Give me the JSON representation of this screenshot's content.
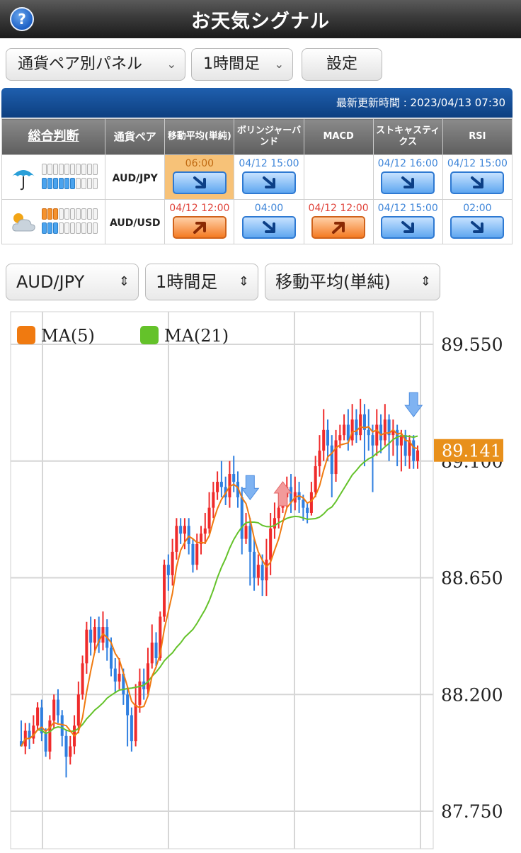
{
  "header": {
    "help_icon": "?",
    "title": "お天気シグナル"
  },
  "toolbar": {
    "panel_select": "通貨ペア別パネル",
    "timeframe_select": "1時間足",
    "settings_button": "設定"
  },
  "update": {
    "text": "最新更新時間 : 2023/04/13 07:30"
  },
  "table": {
    "headers": [
      "総合判断",
      "通貨ペア",
      "移動平均(単純)",
      "ボリンジャーバンド",
      "MACD",
      "ストキャスティクス",
      "RSI"
    ],
    "rows": [
      {
        "weather": "umbrella-rain-icon",
        "meter_top_lit": 0,
        "meter_bottom_lit": 6,
        "pair": "AUD/JPY",
        "signals": [
          {
            "time": "06:00",
            "dir": "down",
            "highlight": true
          },
          {
            "time": "04/12 15:00",
            "dir": "down"
          },
          {
            "time": "",
            "dir": ""
          },
          {
            "time": "04/12 16:00",
            "dir": "down"
          },
          {
            "time": "04/12 15:00",
            "dir": "down"
          }
        ]
      },
      {
        "weather": "cloudy-icon",
        "meter_top_lit": 3,
        "meter_bottom_lit": 3,
        "pair": "AUD/USD",
        "signals": [
          {
            "time": "04/12 12:00",
            "dir": "up"
          },
          {
            "time": "04:00",
            "dir": "down"
          },
          {
            "time": "04/12 12:00",
            "dir": "up"
          },
          {
            "time": "04/12 15:00",
            "dir": "down"
          },
          {
            "time": "02:00",
            "dir": "down"
          }
        ]
      }
    ]
  },
  "chart_controls": {
    "pair": "AUD/JPY",
    "timeframe": "1時間足",
    "indicator": "移動平均(単純)"
  },
  "chart_data": {
    "type": "candlestick",
    "legend": [
      {
        "name": "MA(5)",
        "color": "#f07a10"
      },
      {
        "name": "MA(21)",
        "color": "#64c22a"
      }
    ],
    "y_ticks": [
      "89.550",
      "89.100",
      "88.650",
      "88.200",
      "87.750"
    ],
    "ylim": [
      87.75,
      89.55
    ],
    "current_price": "89.141",
    "up_color": "#ef2b2b",
    "down_color": "#2f7fe0",
    "candles": [
      [
        88.02,
        88.0,
        88.1,
        88.0
      ],
      [
        88.0,
        88.06,
        88.09,
        87.97
      ],
      [
        88.06,
        88.03,
        88.09,
        87.99
      ],
      [
        88.03,
        88.08,
        88.12,
        88.01
      ],
      [
        88.08,
        88.15,
        88.17,
        88.06
      ],
      [
        88.15,
        88.05,
        88.18,
        88.02
      ],
      [
        88.05,
        87.98,
        88.07,
        87.96
      ],
      [
        87.98,
        88.1,
        88.12,
        87.95
      ],
      [
        88.1,
        88.18,
        88.2,
        88.07
      ],
      [
        88.18,
        88.12,
        88.22,
        88.09
      ],
      [
        88.12,
        88.04,
        88.14,
        88.0
      ],
      [
        88.04,
        87.96,
        88.06,
        87.88
      ],
      [
        87.96,
        88.0,
        88.04,
        87.93
      ],
      [
        88.0,
        88.08,
        88.12,
        87.97
      ],
      [
        88.08,
        88.2,
        88.25,
        88.05
      ],
      [
        88.2,
        88.32,
        88.35,
        88.18
      ],
      [
        88.32,
        88.45,
        88.48,
        88.28
      ],
      [
        88.45,
        88.4,
        88.5,
        88.35
      ],
      [
        88.4,
        88.46,
        88.49,
        88.36
      ],
      [
        88.46,
        88.4,
        88.5,
        88.36
      ],
      [
        88.4,
        88.46,
        88.52,
        88.37
      ],
      [
        88.46,
        88.38,
        88.49,
        88.33
      ],
      [
        88.38,
        88.3,
        88.42,
        88.27
      ],
      [
        88.3,
        88.25,
        88.34,
        88.21
      ],
      [
        88.25,
        88.28,
        88.34,
        88.22
      ],
      [
        88.28,
        88.2,
        88.3,
        88.16
      ],
      [
        88.2,
        88.12,
        88.23,
        88.0
      ],
      [
        88.12,
        88.02,
        88.15,
        87.98
      ],
      [
        88.02,
        88.16,
        88.24,
        88.0
      ],
      [
        88.16,
        88.25,
        88.3,
        88.13
      ],
      [
        88.25,
        88.22,
        88.3,
        88.18
      ],
      [
        88.22,
        88.32,
        88.38,
        88.2
      ],
      [
        88.32,
        88.4,
        88.47,
        88.3
      ],
      [
        88.4,
        88.34,
        88.44,
        88.31
      ],
      [
        88.34,
        88.5,
        88.52,
        88.33
      ],
      [
        88.5,
        88.7,
        88.72,
        88.48
      ],
      [
        88.7,
        88.66,
        88.74,
        88.6
      ],
      [
        88.66,
        88.75,
        88.8,
        88.62
      ],
      [
        88.75,
        88.85,
        88.88,
        88.72
      ],
      [
        88.85,
        88.82,
        88.88,
        88.78
      ],
      [
        88.82,
        88.85,
        88.88,
        88.76
      ],
      [
        88.85,
        88.78,
        88.88,
        88.74
      ],
      [
        88.78,
        88.7,
        88.8,
        88.67
      ],
      [
        88.7,
        88.78,
        88.82,
        88.68
      ],
      [
        88.78,
        88.82,
        88.85,
        88.74
      ],
      [
        88.82,
        88.84,
        88.9,
        88.78
      ],
      [
        88.84,
        88.92,
        88.98,
        88.82
      ],
      [
        88.92,
        88.98,
        89.02,
        88.88
      ],
      [
        88.98,
        89.02,
        89.06,
        88.95
      ],
      [
        89.02,
        89.0,
        89.1,
        88.96
      ],
      [
        89.0,
        88.96,
        89.04,
        88.93
      ],
      [
        88.96,
        89.05,
        89.1,
        88.92
      ],
      [
        89.05,
        89.02,
        89.12,
        88.98
      ],
      [
        89.02,
        88.96,
        89.06,
        88.92
      ],
      [
        88.96,
        88.8,
        89.0,
        88.74
      ],
      [
        88.8,
        88.85,
        88.9,
        88.78
      ],
      [
        88.85,
        88.75,
        88.88,
        88.62
      ],
      [
        88.75,
        88.65,
        88.8,
        88.6
      ],
      [
        88.65,
        88.7,
        88.74,
        88.62
      ],
      [
        88.7,
        88.64,
        88.74,
        88.58
      ],
      [
        88.64,
        88.72,
        88.8,
        88.58
      ],
      [
        88.72,
        88.84,
        88.9,
        88.66
      ],
      [
        88.84,
        88.88,
        88.94,
        88.8
      ],
      [
        88.88,
        88.92,
        88.98,
        88.84
      ],
      [
        88.92,
        88.96,
        89.02,
        88.9
      ],
      [
        88.96,
        89.0,
        89.04,
        88.92
      ],
      [
        89.0,
        88.94,
        89.05,
        88.9
      ],
      [
        88.94,
        88.98,
        89.04,
        88.91
      ],
      [
        88.98,
        88.95,
        89.02,
        88.9
      ],
      [
        88.95,
        88.92,
        88.97,
        88.87
      ],
      [
        88.92,
        88.9,
        88.94,
        88.86
      ],
      [
        88.9,
        88.98,
        89.02,
        88.89
      ],
      [
        88.98,
        89.08,
        89.12,
        88.96
      ],
      [
        89.08,
        89.14,
        89.2,
        89.04
      ],
      [
        89.14,
        89.22,
        89.3,
        89.1
      ],
      [
        89.22,
        89.16,
        89.26,
        89.1
      ],
      [
        89.16,
        89.05,
        89.2,
        88.96
      ],
      [
        89.05,
        89.18,
        89.22,
        89.02
      ],
      [
        89.18,
        89.2,
        89.24,
        89.15
      ],
      [
        89.2,
        89.24,
        89.28,
        89.18
      ],
      [
        89.24,
        89.18,
        89.3,
        89.14
      ],
      [
        89.18,
        89.26,
        89.32,
        89.16
      ],
      [
        89.26,
        89.2,
        89.3,
        89.17
      ],
      [
        89.2,
        89.28,
        89.34,
        89.18
      ],
      [
        89.28,
        89.22,
        89.32,
        89.08
      ],
      [
        89.22,
        89.2,
        89.3,
        89.14
      ],
      [
        89.2,
        89.16,
        89.24,
        88.98
      ],
      [
        89.16,
        89.24,
        89.3,
        89.12
      ],
      [
        89.24,
        89.18,
        89.28,
        89.13
      ],
      [
        89.18,
        89.26,
        89.32,
        89.16
      ],
      [
        89.26,
        89.2,
        89.28,
        89.1
      ],
      [
        89.2,
        89.22,
        89.26,
        89.12
      ],
      [
        89.22,
        89.16,
        89.24,
        89.08
      ],
      [
        89.16,
        89.2,
        89.22,
        89.06
      ],
      [
        89.2,
        89.12,
        89.22,
        89.08
      ],
      [
        89.12,
        89.18,
        89.2,
        89.07
      ],
      [
        89.18,
        89.1,
        89.2,
        89.07
      ],
      [
        89.1,
        89.141,
        89.16,
        89.07
      ]
    ],
    "markers": [
      {
        "index": 56,
        "dir": "down"
      },
      {
        "index": 64,
        "dir": "up"
      },
      {
        "index": 96,
        "dir": "down"
      }
    ]
  }
}
